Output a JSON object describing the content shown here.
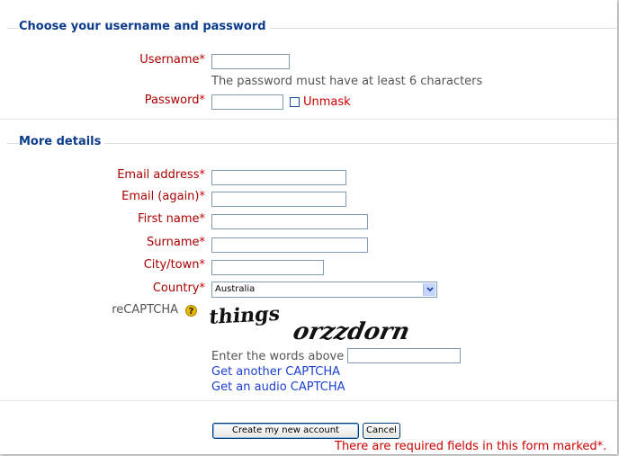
{
  "section1": {
    "legend": "Choose your username and password",
    "username_label": "Username",
    "password_hint": "The password must have at least 6 characters",
    "password_label": "Password",
    "unmask_label": "Unmask",
    "required_mark": "*"
  },
  "section2": {
    "legend": "More details",
    "email_label": "Email address",
    "email_again_label": "Email (again)",
    "firstname_label": "First name",
    "surname_label": "Surname",
    "city_label": "City/town",
    "country_label": "Country",
    "country_value": "Australia",
    "recaptcha_label": "reCAPTCHA",
    "help_icon_glyph": "?",
    "captcha_words": [
      "things",
      "orzzdorn"
    ],
    "captcha_prompt": "Enter the words above",
    "another_captcha": "Get another CAPTCHA",
    "audio_captcha": "Get an audio CAPTCHA"
  },
  "actions": {
    "create_label": "Create my new account",
    "cancel_label": "Cancel",
    "required_note": "There are required fields in this form marked*."
  },
  "colors": {
    "legend": "#0b3b8c",
    "required_label": "#a90000",
    "link": "#1a3fd1",
    "input_border": "#7f9db9"
  },
  "icons": {
    "help": "help-icon",
    "dropdown": "chevron-down-icon"
  }
}
